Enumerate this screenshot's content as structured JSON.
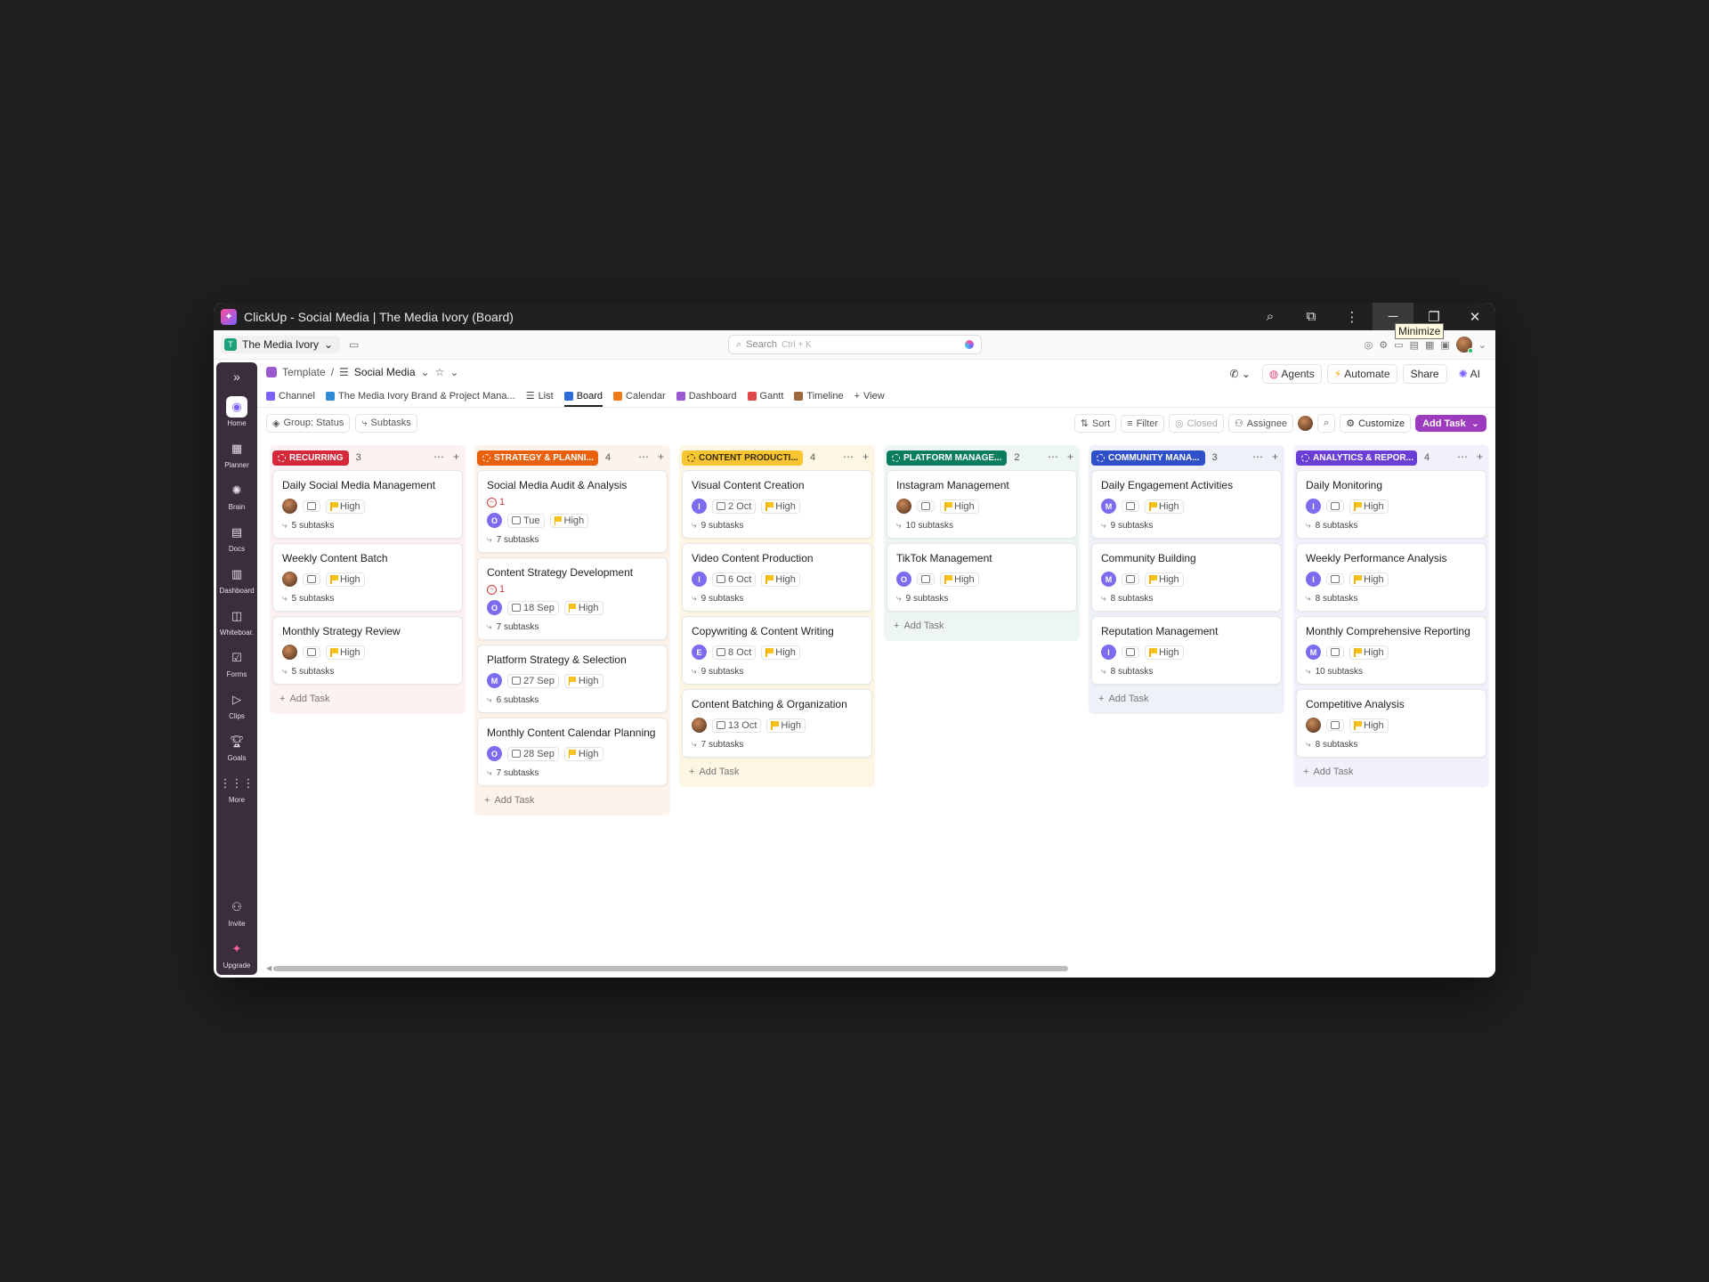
{
  "window": {
    "title": "ClickUp - Social Media | The Media Ivory (Board)",
    "tooltip": "Minimize"
  },
  "topbar": {
    "workspace_initial": "T",
    "workspace_name": "The Media Ivory",
    "search_placeholder": "Search",
    "search_shortcut": "Ctrl + K"
  },
  "rail": {
    "items": [
      {
        "label": "Home",
        "icon": "home-icon"
      },
      {
        "label": "Planner",
        "icon": "planner-icon"
      },
      {
        "label": "Brain",
        "icon": "brain-icon"
      },
      {
        "label": "Docs",
        "icon": "docs-icon"
      },
      {
        "label": "Dashboard",
        "icon": "dashboard-icon"
      },
      {
        "label": "Whiteboar.",
        "icon": "whiteboard-icon"
      },
      {
        "label": "Forms",
        "icon": "forms-icon"
      },
      {
        "label": "Clips",
        "icon": "clips-icon"
      },
      {
        "label": "Goals",
        "icon": "goals-icon"
      },
      {
        "label": "More",
        "icon": "grid-icon"
      }
    ],
    "invite": "Invite",
    "upgrade": "Upgrade"
  },
  "breadcrumb": {
    "template": "Template",
    "current": "Social Media"
  },
  "header_actions": {
    "agents": "Agents",
    "automate": "Automate",
    "share": "Share",
    "ai": "AI"
  },
  "views": {
    "channel": "Channel",
    "doc": "The Media Ivory Brand & Project Mana...",
    "list": "List",
    "board": "Board",
    "calendar": "Calendar",
    "dashboard": "Dashboard",
    "gantt": "Gantt",
    "timeline": "Timeline",
    "add_view": "View"
  },
  "filters": {
    "group": "Group: Status",
    "subtasks": "Subtasks",
    "sort": "Sort",
    "filter": "Filter",
    "closed": "Closed",
    "assignee": "Assignee",
    "customize": "Customize",
    "add_task": "Add Task"
  },
  "colors": {
    "recurring": "#d5283a",
    "strategy": "#e8600c",
    "content": "#f7c531",
    "platform": "#0a7d5e",
    "community": "#2f50c9",
    "analytics": "#6a3fd6",
    "accent": "#9c3bbd"
  },
  "board": {
    "add_task_label": "Add Task",
    "columns": [
      {
        "status": "RECURRING",
        "count": "3",
        "tasks": [
          {
            "title": "Daily Social Media Management",
            "assignee": "photo",
            "date": "",
            "priority": "High",
            "subtasks": "5 subtasks"
          },
          {
            "title": "Weekly Content Batch",
            "assignee": "photo",
            "date": "",
            "priority": "High",
            "subtasks": "5 subtasks"
          },
          {
            "title": "Monthly Strategy Review",
            "assignee": "photo",
            "date": "",
            "priority": "High",
            "subtasks": "5 subtasks"
          }
        ]
      },
      {
        "status": "STRATEGY & PLANNI...",
        "count": "4",
        "tasks": [
          {
            "title": "Social Media Audit & Analysis",
            "alert": "1",
            "assignee": "O",
            "date": "Tue",
            "priority": "High",
            "subtasks": "7 subtasks"
          },
          {
            "title": "Content Strategy Development",
            "alert": "1",
            "assignee": "O",
            "date": "18 Sep",
            "priority": "High",
            "subtasks": "7 subtasks"
          },
          {
            "title": "Platform Strategy & Selection",
            "assignee": "M",
            "date": "27 Sep",
            "priority": "High",
            "subtasks": "6 subtasks"
          },
          {
            "title": "Monthly Content Calendar Planning",
            "assignee": "O",
            "date": "28 Sep",
            "priority": "High",
            "subtasks": "7 subtasks"
          }
        ]
      },
      {
        "status": "CONTENT PRODUCTI...",
        "count": "4",
        "tasks": [
          {
            "title": "Visual Content Creation",
            "assignee": "I",
            "date": "2 Oct",
            "priority": "High",
            "subtasks": "9 subtasks"
          },
          {
            "title": "Video Content Production",
            "assignee": "I",
            "date": "6 Oct",
            "priority": "High",
            "subtasks": "9 subtasks"
          },
          {
            "title": "Copywriting & Content Writing",
            "assignee": "E",
            "date": "8 Oct",
            "priority": "High",
            "subtasks": "9 subtasks"
          },
          {
            "title": "Content Batching & Organization",
            "assignee": "photo",
            "date": "13 Oct",
            "priority": "High",
            "subtasks": "7 subtasks"
          }
        ]
      },
      {
        "status": "PLATFORM MANAGE...",
        "count": "2",
        "tasks": [
          {
            "title": "Instagram Management",
            "assignee": "photo",
            "date": "",
            "priority": "High",
            "subtasks": "10 subtasks"
          },
          {
            "title": "TikTok Management",
            "assignee": "O",
            "date": "",
            "priority": "High",
            "subtasks": "9 subtasks"
          }
        ]
      },
      {
        "status": "COMMUNITY MANA...",
        "count": "3",
        "tasks": [
          {
            "title": "Daily Engagement Activities",
            "assignee": "M",
            "date": "",
            "priority": "High",
            "subtasks": "9 subtasks"
          },
          {
            "title": "Community Building",
            "assignee": "M",
            "date": "",
            "priority": "High",
            "subtasks": "8 subtasks"
          },
          {
            "title": "Reputation Management",
            "assignee": "I",
            "date": "",
            "priority": "High",
            "subtasks": "8 subtasks"
          }
        ]
      },
      {
        "status": "ANALYTICS & REPOR...",
        "count": "4",
        "tasks": [
          {
            "title": "Daily Monitoring",
            "assignee": "I",
            "date": "",
            "priority": "High",
            "subtasks": "8 subtasks"
          },
          {
            "title": "Weekly Performance Analysis",
            "assignee": "I",
            "date": "",
            "priority": "High",
            "subtasks": "8 subtasks"
          },
          {
            "title": "Monthly Comprehensive Reporting",
            "assignee": "M",
            "date": "",
            "priority": "High",
            "subtasks": "10 subtasks"
          },
          {
            "title": "Competitive Analysis",
            "assignee": "photo",
            "date": "",
            "priority": "High",
            "subtasks": "8 subtasks"
          }
        ]
      }
    ]
  }
}
